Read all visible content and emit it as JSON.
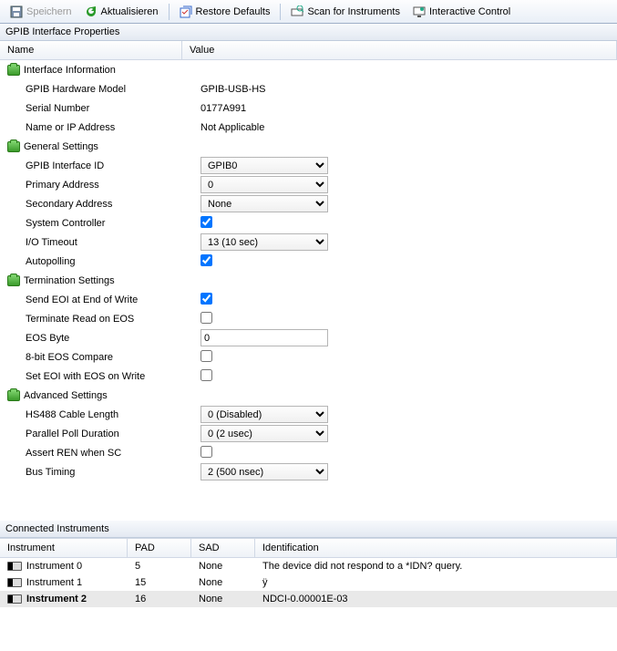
{
  "toolbar": {
    "save": "Speichern",
    "refresh": "Aktualisieren",
    "restore": "Restore Defaults",
    "scan": "Scan for Instruments",
    "interactive": "Interactive Control"
  },
  "panel_title": "GPIB Interface Properties",
  "headers": {
    "name": "Name",
    "value": "Value"
  },
  "cats": {
    "info": "Interface Information",
    "general": "General Settings",
    "term": "Termination Settings",
    "adv": "Advanced Settings"
  },
  "info": {
    "hw_model_label": "GPIB Hardware Model",
    "hw_model": "GPIB-USB-HS",
    "serial_label": "Serial Number",
    "serial": "0177A991",
    "name_ip_label": "Name or IP Address",
    "name_ip": "Not Applicable"
  },
  "general": {
    "iface_id_label": "GPIB Interface ID",
    "iface_id": "GPIB0",
    "primary_label": "Primary Address",
    "primary": "0",
    "secondary_label": "Secondary Address",
    "secondary": "None",
    "syscon_label": "System Controller",
    "syscon": true,
    "timeout_label": "I/O Timeout",
    "timeout": "13 (10 sec)",
    "autopoll_label": "Autopolling",
    "autopoll": true
  },
  "term": {
    "send_eoi_label": "Send EOI at End of Write",
    "send_eoi": true,
    "term_read_label": "Terminate Read on EOS",
    "term_read": false,
    "eos_byte_label": "EOS Byte",
    "eos_byte": "0",
    "cmp8_label": "8-bit EOS Compare",
    "cmp8": false,
    "set_eoi_label": "Set EOI with EOS on Write",
    "set_eoi": false
  },
  "adv": {
    "hs488_label": "HS488 Cable Length",
    "hs488": "0   (Disabled)",
    "ppoll_label": "Parallel Poll Duration",
    "ppoll": "0   (2 usec)",
    "ren_label": "Assert REN when SC",
    "ren": false,
    "bus_label": "Bus Timing",
    "bus": "2 (500 nsec)"
  },
  "connected_title": "Connected Instruments",
  "conn_headers": {
    "inst": "Instrument",
    "pad": "PAD",
    "sad": "SAD",
    "id": "Identification"
  },
  "instruments": [
    {
      "name": "Instrument 0",
      "pad": "5",
      "sad": "None",
      "id": "The device did not respond to a *IDN? query."
    },
    {
      "name": "Instrument 1",
      "pad": "15",
      "sad": "None",
      "id": "ÿ"
    },
    {
      "name": "Instrument 2",
      "pad": "16",
      "sad": "None",
      "id": "NDCI-0.00001E-03"
    }
  ]
}
